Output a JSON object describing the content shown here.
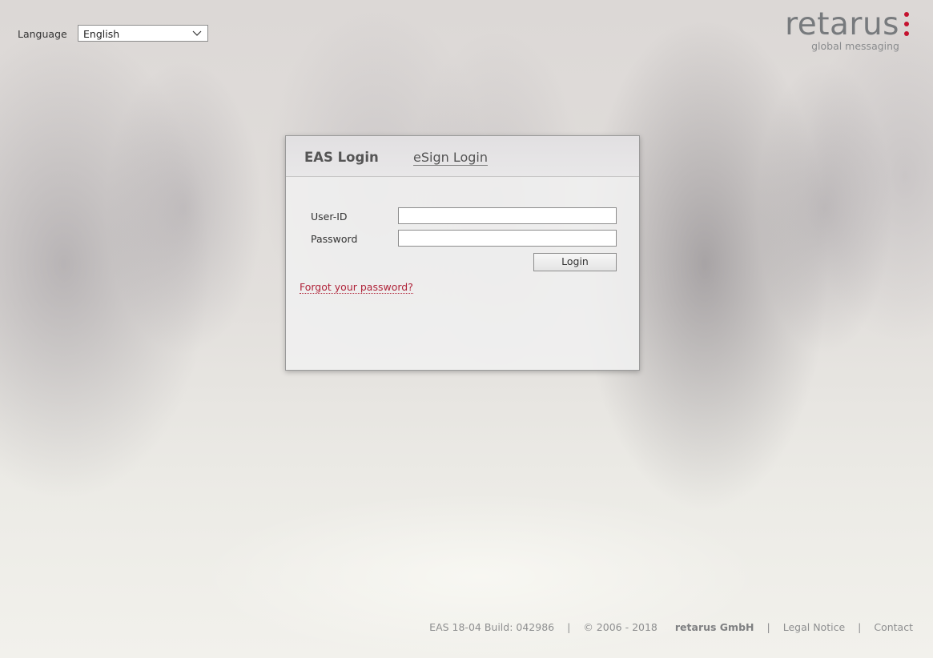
{
  "header": {
    "language_label": "Language",
    "language_value": "English",
    "logo_word": "retarus",
    "logo_tagline": "global messaging",
    "brand_color": "#c4122f",
    "logo_icon": "three-red-dots"
  },
  "login": {
    "tab_eas": "EAS Login",
    "tab_esign": "eSign Login",
    "userid_label": "User-ID",
    "userid_value": "",
    "password_label": "Password",
    "password_value": "",
    "login_button": "Login",
    "forgot_link": "Forgot your password?"
  },
  "footer": {
    "build": "EAS 18-04 Build: 042986",
    "copyright": "© 2006 - 2018",
    "company": "retarus GmbH",
    "legal": "Legal Notice",
    "contact": "Contact",
    "separator": "|"
  }
}
